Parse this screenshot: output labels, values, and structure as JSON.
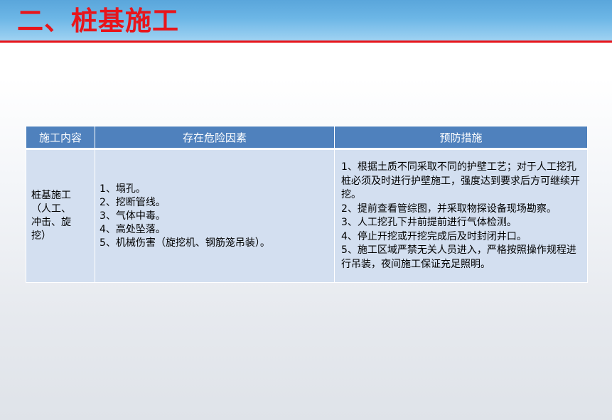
{
  "header": {
    "title": "二、桩基施工"
  },
  "table": {
    "columns": [
      "施工内容",
      "存在危险因素",
      "预防措施"
    ],
    "row": {
      "task_lines": [
        "桩基施工",
        "（人工、",
        "冲击、旋",
        "挖）"
      ],
      "hazards": [
        "1、塌孔。",
        "2、挖断管线。",
        "3、气体中毒。",
        "4、高处坠落。",
        "5、机械伤害（旋挖机、钢筋笼吊装）。"
      ],
      "measures": [
        "1、根据土质不同采取不同的护壁工艺；对于人工挖孔桩必须及时进行护壁施工，强度达到要求后方可继续开挖。",
        "2、提前查看管综图，并采取物探设备现场勘察。",
        "3、人工挖孔下井前提前进行气体检测。",
        "4、停止开挖或开挖完成后及时封闭井口。",
        "5、施工区域严禁无关人员进入，严格按照操作规程进行吊装，夜间施工保证充足照明。"
      ]
    }
  },
  "colors": {
    "title_red": "#e8151b",
    "header_bar_blue": "#5aa6db",
    "table_header_blue": "#4f81bd",
    "table_cell_blue": "#d3dff0"
  }
}
